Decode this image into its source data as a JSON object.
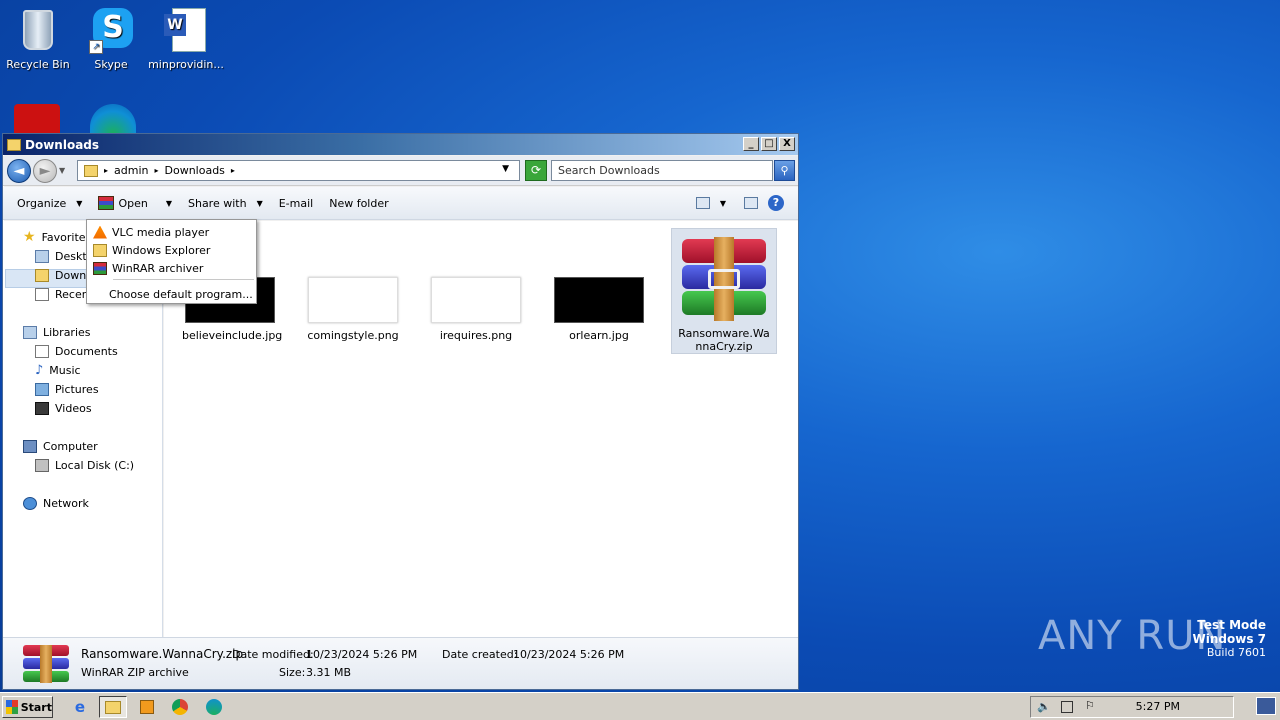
{
  "desktop": {
    "icons": [
      {
        "label": "Recycle Bin"
      },
      {
        "label": "Skype"
      },
      {
        "label": "minprovidin..."
      }
    ]
  },
  "window": {
    "title": "Downloads",
    "controls": {
      "minimize": "_",
      "maximize": "□",
      "close": "X"
    }
  },
  "address": {
    "crumbs": [
      "admin",
      "Downloads"
    ],
    "search_placeholder": "Search Downloads"
  },
  "toolbar": {
    "organize": "Organize",
    "open": "Open",
    "share_with": "Share with",
    "email": "E-mail",
    "new_folder": "New folder"
  },
  "open_menu": {
    "items": [
      "VLC media player",
      "Windows Explorer",
      "WinRAR archiver"
    ],
    "default_program": "Choose default program..."
  },
  "nav": {
    "favorites": "Favorites",
    "desktop": "Deskto",
    "downloads": "Downlo",
    "recent": "Recent",
    "libraries": "Libraries",
    "documents": "Documents",
    "music": "Music",
    "pictures": "Pictures",
    "videos": "Videos",
    "computer": "Computer",
    "local_disk": "Local Disk (C:)",
    "network": "Network"
  },
  "files": [
    {
      "name": "believeinclude.jpg",
      "thumb": "black"
    },
    {
      "name": "comingstyle.png",
      "thumb": "white"
    },
    {
      "name": "irequires.png",
      "thumb": "white"
    },
    {
      "name": "orlearn.jpg",
      "thumb": "black"
    },
    {
      "name": "Ransomware.WannaCry.zip",
      "thumb": "winrar",
      "selected": true
    }
  ],
  "details": {
    "filename": "Ransomware.WannaCry.zip",
    "type": "WinRAR ZIP archive",
    "modified_label": "Date modified:",
    "modified_value": "10/23/2024 5:26 PM",
    "created_label": "Date created:",
    "created_value": "10/23/2024 5:26 PM",
    "size_label": "Size:",
    "size_value": "3.31 MB"
  },
  "taskbar": {
    "start": "Start",
    "clock": "5:27 PM"
  },
  "watermark": {
    "line1": "Test Mode",
    "line2": "Windows 7",
    "line3": "Build 7601",
    "brand": "ANY RUN"
  }
}
